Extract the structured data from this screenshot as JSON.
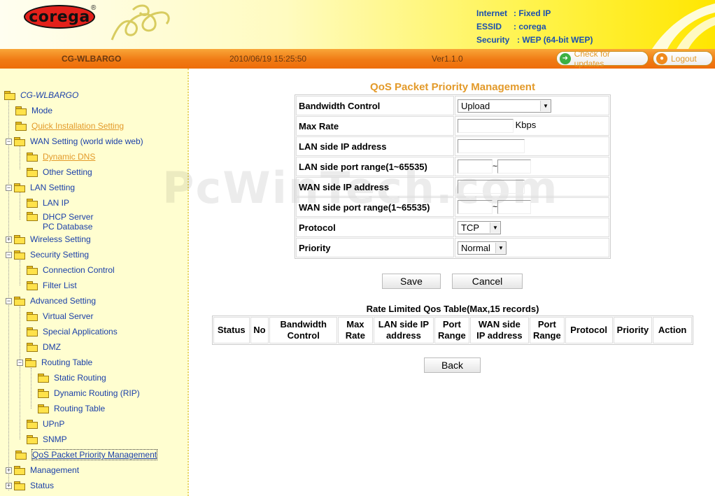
{
  "header": {
    "logo_text": "corega",
    "logo_reg": "®",
    "status": [
      {
        "key": "Internet",
        "value": ": Fixed IP"
      },
      {
        "key": "ESSID",
        "value": ": corega"
      },
      {
        "key": "Security",
        "value": ": WEP (64-bit WEP)"
      }
    ]
  },
  "bar": {
    "device": "CG-WLBARGO",
    "datetime": "2010/06/19 15:25:50",
    "version": "Ver1.1.0",
    "check_updates": "Check for updates",
    "logout": "Logout"
  },
  "sidebar": {
    "items": [
      {
        "label": "CG-WLBARGO"
      },
      {
        "label": "Mode"
      },
      {
        "label": "Quick Installation Setting"
      },
      {
        "label": "WAN Setting (world wide web)"
      },
      {
        "label": "Dynamic DNS"
      },
      {
        "label": "Other Setting"
      },
      {
        "label": "LAN Setting"
      },
      {
        "label": "LAN IP"
      },
      {
        "label": "DHCP Server",
        "label2": "PC Database"
      },
      {
        "label": "Wireless Setting"
      },
      {
        "label": "Security Setting"
      },
      {
        "label": "Connection Control"
      },
      {
        "label": "Filter List"
      },
      {
        "label": "Advanced Setting"
      },
      {
        "label": "Virtual Server"
      },
      {
        "label": "Special Applications"
      },
      {
        "label": "DMZ"
      },
      {
        "label": "Routing Table"
      },
      {
        "label": "Static Routing"
      },
      {
        "label": "Dynamic Routing (RIP)"
      },
      {
        "label": "Routing Table"
      },
      {
        "label": "UPnP"
      },
      {
        "label": "SNMP"
      },
      {
        "label": "QoS Packet Priority Management"
      },
      {
        "label": "Management"
      },
      {
        "label": "Status"
      }
    ]
  },
  "watermark": "PcWinTech.com",
  "form": {
    "title": "QoS Packet Priority Management",
    "bandwidth_label": "Bandwidth Control",
    "bandwidth_value": "Upload",
    "maxrate_label": "Max Rate",
    "maxrate_unit": "Kbps",
    "maxrate_value": "",
    "lan_ip_label": "LAN side IP address",
    "lan_port_label": "LAN side port range(1~65535)",
    "wan_ip_label": "WAN side IP address",
    "wan_port_label": "WAN side port range(1~65535)",
    "range_sep": "~",
    "protocol_label": "Protocol",
    "protocol_value": "TCP",
    "priority_label": "Priority",
    "priority_value": "Normal",
    "save": "Save",
    "cancel": "Cancel"
  },
  "rate_table": {
    "title": "Rate Limited Qos Table(Max,15 records)",
    "headers": [
      [
        "Status"
      ],
      [
        "No"
      ],
      [
        "Bandwidth",
        "Control"
      ],
      [
        "Max",
        "Rate"
      ],
      [
        "LAN side IP",
        "address"
      ],
      [
        "Port",
        "Range"
      ],
      [
        "WAN side",
        "IP address"
      ],
      [
        "Port",
        "Range"
      ],
      [
        "Protocol"
      ],
      [
        "Priority"
      ],
      [
        "Action"
      ]
    ]
  },
  "back": "Back",
  "colors": {
    "accent_orange": "#e39a2a",
    "link_blue": "#1a3fa8",
    "status_blue": "#1a4fb0",
    "sidebar_bg": "#fffed0",
    "bar_orange": "#f07a14"
  }
}
